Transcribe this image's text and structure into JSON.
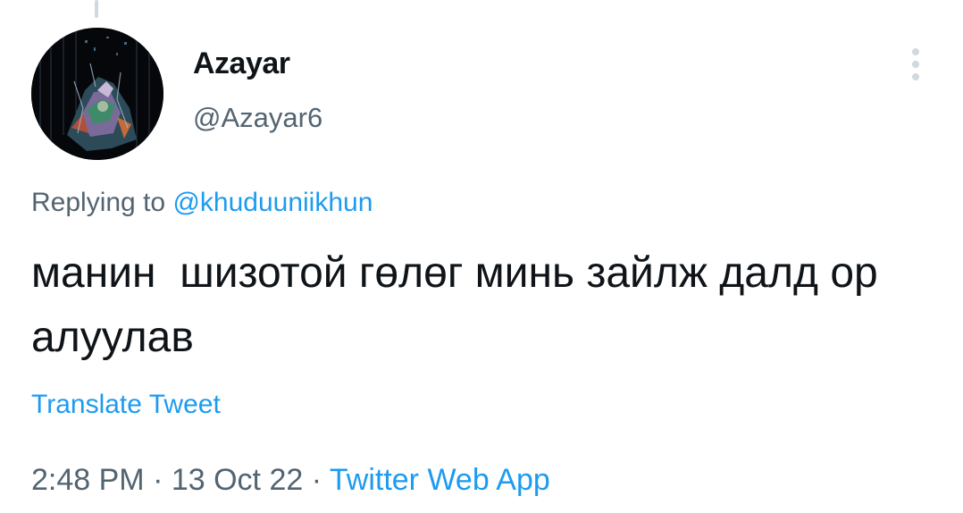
{
  "tweet": {
    "author": {
      "display_name": "Azayar",
      "handle": "@Azayar6"
    },
    "more_icon": "ellipsis-vertical-icon",
    "reply": {
      "prefix": "Replying to ",
      "mention": "@khuduuniikhun"
    },
    "text": "манин  шизотой гөлөг минь зайлж далд ор алуулав",
    "translate_label": "Translate Tweet",
    "time": "2:48 PM",
    "separator": " · ",
    "date": "13 Oct 22",
    "source": "Twitter Web App"
  },
  "colors": {
    "primary_text": "#0f1419",
    "secondary_text": "#536471",
    "link": "#1d9bf0",
    "divider": "#cfd9de"
  }
}
